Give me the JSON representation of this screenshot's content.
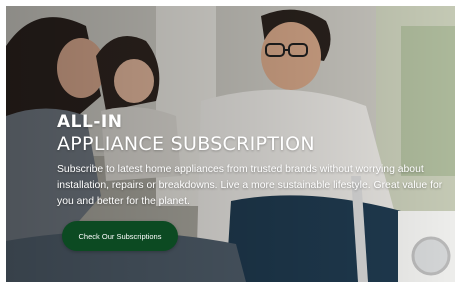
{
  "hero": {
    "kicker": "ALL-IN",
    "headline": "APPLIANCE SUBSCRIPTION",
    "description": "Subscribe to latest home appliances from trusted brands without worrying about installation, repairs or breakdowns. Live a more sustainable lifestyle. Great value for you and better for the planet.",
    "cta_label": "Check Our Subscriptions",
    "colors": {
      "cta_background": "#0c4a22",
      "text": "#ffffff"
    }
  }
}
